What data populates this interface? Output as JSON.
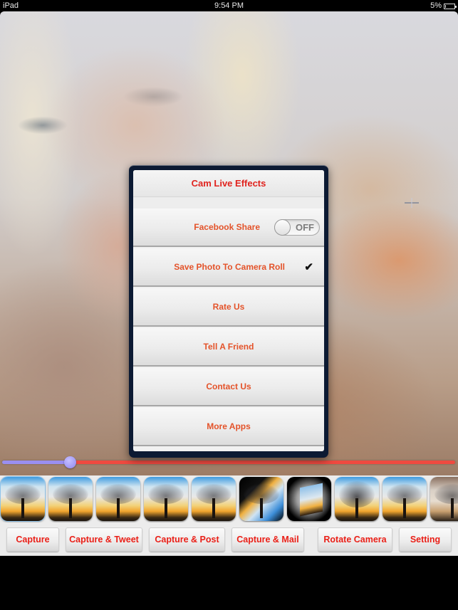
{
  "status_bar": {
    "device": "iPad",
    "time": "9:54 PM",
    "battery_text": "5%",
    "battery_level": 0.05
  },
  "preview": {
    "description": "Live camera preview of a woman's face with a soft filter"
  },
  "zoom_slider": {
    "value": 0.15
  },
  "settings_popover": {
    "title": "Cam Live Effects",
    "items": [
      {
        "label": "Facebook Share",
        "control": "switch",
        "switch_text": "OFF",
        "on": false
      },
      {
        "label": "Save Photo To Camera Roll",
        "control": "checkmark",
        "checked": true,
        "check_glyph": "✔"
      },
      {
        "label": "Rate Us"
      },
      {
        "label": "Tell A Friend"
      },
      {
        "label": "Contact Us"
      },
      {
        "label": "More Apps"
      }
    ]
  },
  "effects": [
    {
      "name": "normal",
      "style": "normal"
    },
    {
      "name": "effect-2",
      "style": "normal"
    },
    {
      "name": "effect-3",
      "style": "normal"
    },
    {
      "name": "effect-4",
      "style": "normal"
    },
    {
      "name": "effect-5",
      "style": "normal"
    },
    {
      "name": "kaleido",
      "style": "dark"
    },
    {
      "name": "cube",
      "style": "cube"
    },
    {
      "name": "blur",
      "style": "blur"
    },
    {
      "name": "effect-9",
      "style": "normal"
    },
    {
      "name": "sepia",
      "style": "sepia"
    }
  ],
  "toolbar": {
    "buttons": [
      {
        "label": "Capture"
      },
      {
        "label": "Capture & Tweet"
      },
      {
        "label": "Capture & Post"
      },
      {
        "label": "Capture & Mail"
      },
      {
        "label": "Rotate Camera"
      },
      {
        "label": "Setting"
      }
    ]
  },
  "colors": {
    "title_red": "#e0231e",
    "item_orange": "#e4532a",
    "button_red": "#ea1f17",
    "slider_min": "#9a8ff0",
    "slider_max": "#ef4a40"
  }
}
